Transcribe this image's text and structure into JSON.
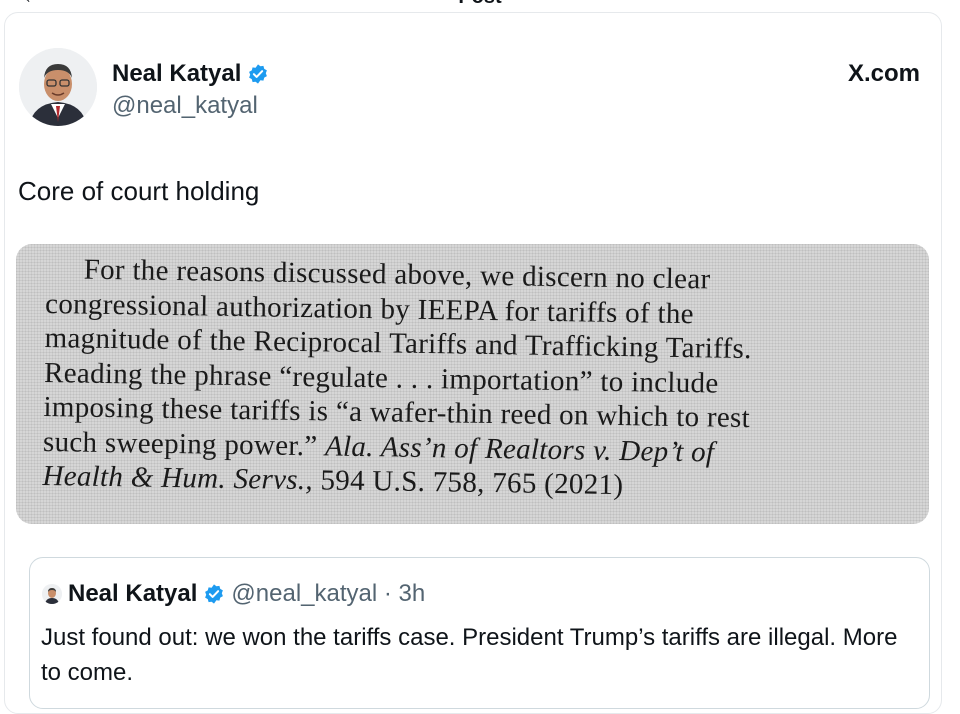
{
  "header": {
    "title": "Post",
    "back_icon": "arrow-left-icon"
  },
  "post": {
    "author_name": "Neal Katyal",
    "handle": "@neal_katyal",
    "source": "X.com",
    "text": "Core of court holding",
    "verified_color": "#1d9bf0"
  },
  "photo": {
    "lines": [
      "For the reasons discussed above, we discern no clear",
      "congressional authorization by IEEPA for tariffs of the",
      "magnitude of the Reciprocal Tariffs and Trafficking Tariffs.",
      "Reading the phrase “regulate . . . importation” to include",
      "imposing these tariffs is “a wafer-thin reed on which to rest",
      "such sweeping power.”"
    ],
    "citation_italic_1": "Ala. Ass’n of Realtors v. Dep’t of",
    "citation_italic_2": "Health & Hum. Servs.,",
    "citation_tail": " 594 U.S. 758, 765 (2021)"
  },
  "quoted": {
    "author_name": "Neal Katyal",
    "handle_time": "@neal_katyal · 3h",
    "text": "Just found out: we won the tariffs case. President Trump’s tariffs are illegal. More to come."
  }
}
